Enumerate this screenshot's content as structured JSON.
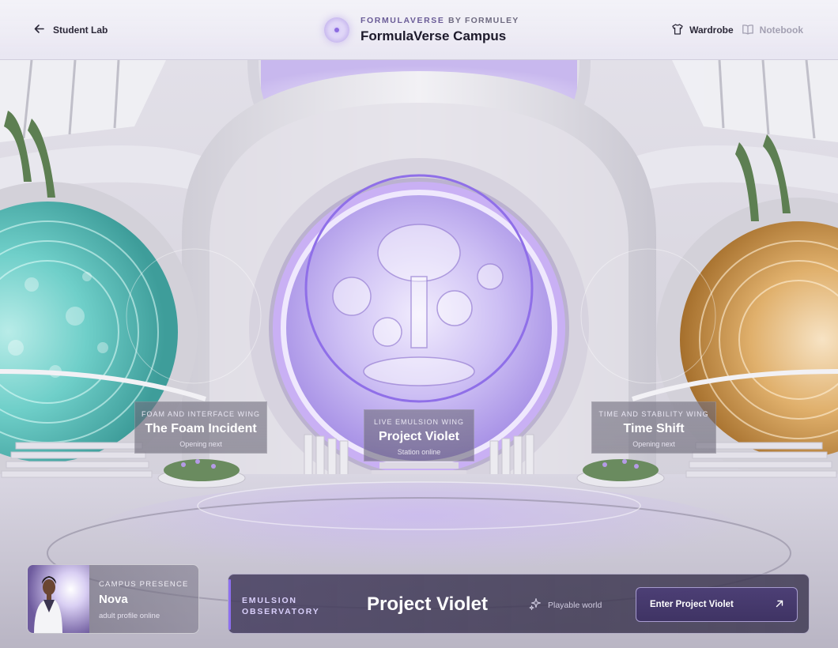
{
  "header": {
    "back_label": "Student Lab",
    "brand_kicker": "FORMULAVERSE",
    "brand_kicker_by": "BY FORMULEY",
    "title": "FormulaVerse Campus",
    "nav": [
      {
        "label": "Wardrobe",
        "icon": "shirt-icon",
        "state": "active"
      },
      {
        "label": "Notebook",
        "icon": "book-icon",
        "state": "muted"
      }
    ]
  },
  "wings": {
    "left": {
      "kicker": "FOAM AND INTERFACE WING",
      "title": "The Foam Incident",
      "status": "Opening next",
      "color": "#5fc9c4"
    },
    "center": {
      "kicker": "LIVE EMULSION WING",
      "title": "Project Violet",
      "status": "Station online",
      "color": "#9b7cf0"
    },
    "right": {
      "kicker": "TIME AND STABILITY WING",
      "title": "Time Shift",
      "status": "Opening next",
      "color": "#d9a45c"
    }
  },
  "presence": {
    "kicker": "CAMPUS PRESENCE",
    "name": "Nova",
    "status": "adult profile online"
  },
  "bottom_bar": {
    "kicker": "EMULSION OBSERVATORY",
    "title": "Project Violet",
    "playable_label": "Playable world",
    "cta_label": "Enter Project Violet",
    "accent": "#8d6ff0"
  }
}
